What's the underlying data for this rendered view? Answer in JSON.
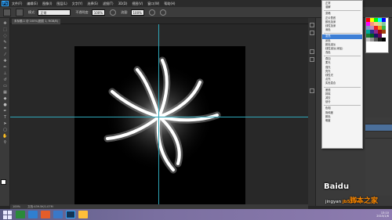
{
  "menubar": {
    "logo": "Ps",
    "items": [
      "文件(F)",
      "编辑(E)",
      "图像(I)",
      "图层(L)",
      "文字(Y)",
      "选择(S)",
      "滤镜(T)",
      "3D(D)",
      "视图(V)",
      "窗口(W)",
      "帮助(H)"
    ]
  },
  "options": {
    "mode_label": "模式:",
    "mode_value": "正常",
    "opacity_label": "不透明度:",
    "opacity_value": "100%",
    "flow_label": "流量:",
    "flow_value": "100%"
  },
  "tab": {
    "label": "未标题-1 @ 100%(图层 1, RGB/8)"
  },
  "blend_menu": {
    "groups": [
      [
        "正常",
        "溶解"
      ],
      [
        "变暗",
        "正片叠底",
        "颜色加深",
        "线性加深",
        "深色"
      ],
      [
        "变亮",
        "滤色",
        "颜色减淡",
        "线性减淡(添加)",
        "浅色"
      ],
      [
        "叠加",
        "柔光",
        "强光",
        "亮光",
        "线性光",
        "点光",
        "实色混合"
      ],
      [
        "差值",
        "排除",
        "减去",
        "划分"
      ],
      [
        "色相",
        "饱和度",
        "颜色",
        "明度"
      ]
    ],
    "selected": "变亮"
  },
  "status": {
    "zoom": "100%",
    "doc": "文档:439.5K/1.07M"
  },
  "taskbar": {
    "time": "13:10",
    "date": "2015/1/6"
  },
  "watermark": {
    "brand": "Baidu",
    "site_cn": "脚本之家",
    "url": "jingyan",
    "site_en": "jb51.net"
  },
  "colors": {
    "guide": "#2fa6b8",
    "selected_item": "#3d7fd6",
    "taskbar": "#7a6fa0"
  }
}
